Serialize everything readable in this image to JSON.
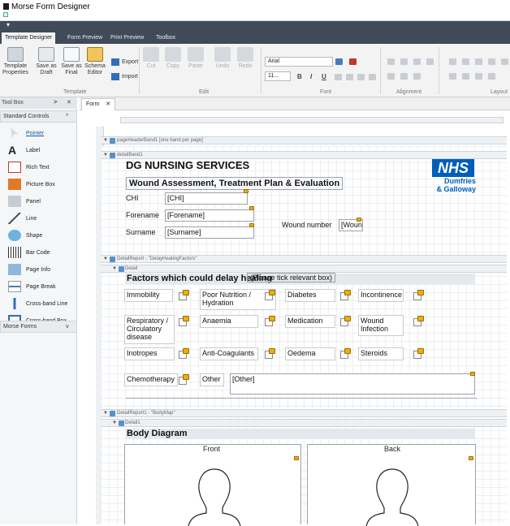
{
  "app": {
    "title": "Morse Form Designer"
  },
  "qat": {
    "arrow": "▾"
  },
  "tabs": [
    "Template Designer",
    "Form Preview",
    "Print Preview",
    "Toolbox"
  ],
  "ribbon": {
    "template_props": "Template Properties",
    "save_draft": "Save as Draft",
    "save_final": "Save as Final",
    "schema": "Schema Editor",
    "export": "Export",
    "import": "Import",
    "cut": "Cut",
    "copy": "Copy",
    "paste": "Paste",
    "undo": "Undo",
    "redo": "Redo",
    "group_template": "Template",
    "group_edit": "Edit",
    "group_font": "Font",
    "group_alignment": "Alignment",
    "group_layout": "Layout",
    "font_name": "Arial",
    "font_size": "11...",
    "bold": "B",
    "italic": "I",
    "underline": "U"
  },
  "toolbox": {
    "title": "Tool Box",
    "pin": "ᗒ",
    "close": "✕",
    "category": "Standard Controls",
    "category_arrow": "^",
    "items": [
      "Pointer",
      "Label",
      "Rich Text",
      "Picture Box",
      "Panel",
      "Line",
      "Shape",
      "Bar Code",
      "Page Info",
      "Page Break",
      "Cross-band Line",
      "Cross-band Box"
    ],
    "footer": "Morse Forms",
    "footer_arrow": "v"
  },
  "doc": {
    "tab": "Form",
    "close": "✕"
  },
  "bands": {
    "pageheader": "pageHeaderBand1 [one band per page]",
    "detail1": "detailBand1",
    "delay": "DetailReport - \"DelayHealingFactors\"",
    "detail_sub": "Detail",
    "bodymap": "DetailReport1 - \"BodyMap\"",
    "detail_sub2": "Detail1"
  },
  "form": {
    "org": "DG NURSING SERVICES",
    "heading": "Wound Assessment, Treatment Plan & Evaluation",
    "nhs": "NHS",
    "nhs_sub1": "Dumfries",
    "nhs_sub2": "& Galloway",
    "chi_label": "CHI",
    "chi_value": "[CHI]",
    "forename_label": "Forename",
    "forename_value": "[Forename]",
    "surname_label": "Surname",
    "surname_value": "[Surname]",
    "wound_label": "Wound number",
    "wound_value": "[Woun"
  },
  "delay": {
    "heading": "Factors which could delay healing",
    "hint": "(Please tick relevant box)",
    "items": [
      "Immobility",
      "Poor Nutrition / Hydration",
      "Diabetes",
      "Incontinence",
      "Respiratory / Circulatory disease",
      "Anaemia",
      "Medication",
      "Wound Infection",
      "Inotropes",
      "Anti-Coagulants",
      "Oedema",
      "Steroids",
      "Chemotherapy",
      "Other"
    ],
    "other_value": "[Other]"
  },
  "body": {
    "heading": "Body Diagram",
    "front": "Front",
    "back": "Back"
  },
  "colors": {
    "nhs_blue": "#005eb8",
    "ribbon_dark": "#404a58",
    "checkbox_mark": "#f0b000"
  }
}
